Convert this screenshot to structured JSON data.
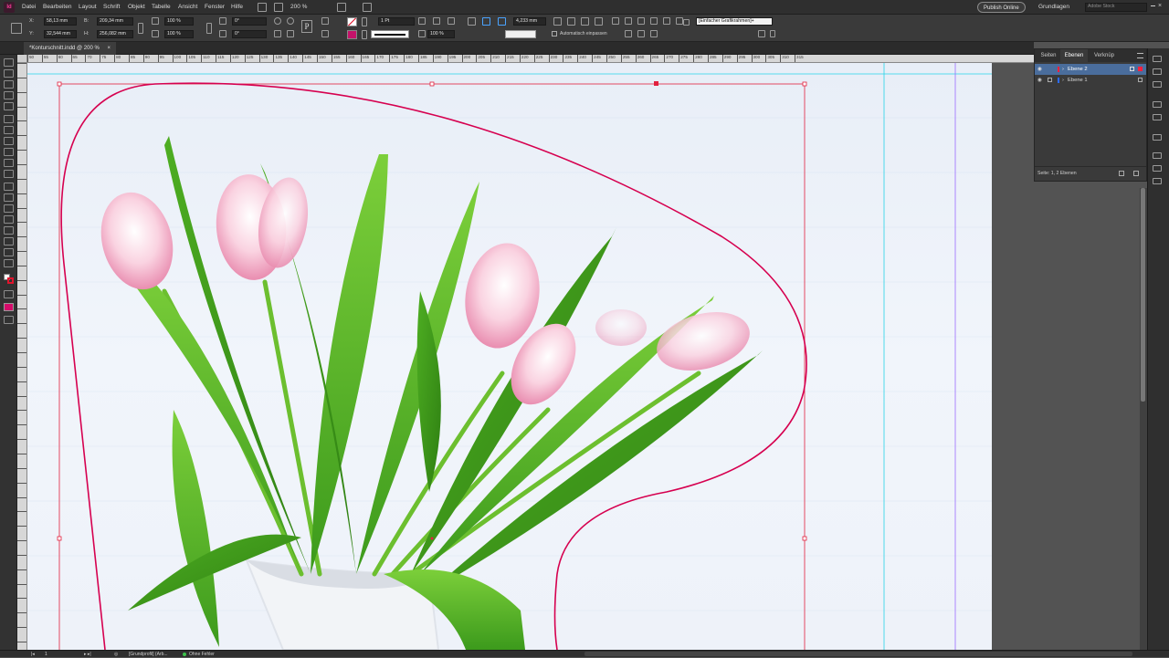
{
  "app": {
    "logo": "Id",
    "menu": [
      "Datei",
      "Bearbeiten",
      "Layout",
      "Schrift",
      "Objekt",
      "Tabelle",
      "Ansicht",
      "Fenster",
      "Hilfe"
    ],
    "zoom": "200 %",
    "publish_label": "Publish Online",
    "workspace": "Grundlagen",
    "stock_placeholder": "Adobe Stock"
  },
  "control": {
    "x_label": "X:",
    "x_value": "58,13 mm",
    "y_label": "Y:",
    "y_value": "32,544 mm",
    "b_label": "B:",
    "b_value": "209,34 mm",
    "h_label": "H:",
    "h_value": "256,082 mm",
    "scale_x": "100 %",
    "scale_y": "100 %",
    "angle": "0°",
    "shear": "0°",
    "stroke_weight": "1 Pt",
    "opacity": "100 %",
    "offset": "4,233 mm",
    "auto_fit_label": "Automatisch einpassen",
    "frame_style": "[Einfacher Grafikrahmen]+"
  },
  "document": {
    "tab_title": "*Konturschnitt.indd @ 200 %"
  },
  "ruler": {
    "ticks": [
      "50",
      "55",
      "60",
      "65",
      "70",
      "75",
      "80",
      "85",
      "90",
      "95",
      "100",
      "105",
      "110",
      "115",
      "120",
      "125",
      "130",
      "135",
      "140",
      "145",
      "150",
      "155",
      "160",
      "165",
      "170",
      "175",
      "180",
      "185",
      "190",
      "195",
      "200",
      "205",
      "210",
      "215",
      "220",
      "225",
      "230",
      "235",
      "240",
      "245",
      "250",
      "255",
      "260",
      "265",
      "270",
      "275",
      "280",
      "285",
      "290",
      "295",
      "300",
      "305",
      "310",
      "315"
    ]
  },
  "layers_panel": {
    "tabs": [
      "Seiten",
      "Ebenen",
      "Verknüp"
    ],
    "layers": [
      {
        "name": "Ebene 2",
        "color": "#ff1f3d",
        "selected": true
      },
      {
        "name": "Ebene 1",
        "color": "#2c6cff",
        "selected": false
      }
    ],
    "footer": "Seite: 1, 2 Ebenen"
  },
  "statusbar": {
    "page": "1",
    "profile": "[Grundprofil] (Arb...",
    "preflight": "Ohne Fehler"
  },
  "colors": {
    "accent": "#d6004f",
    "selection": "#e2203e",
    "guide_cyan": "#25d4e8",
    "guide_violet": "#9a6bff"
  }
}
